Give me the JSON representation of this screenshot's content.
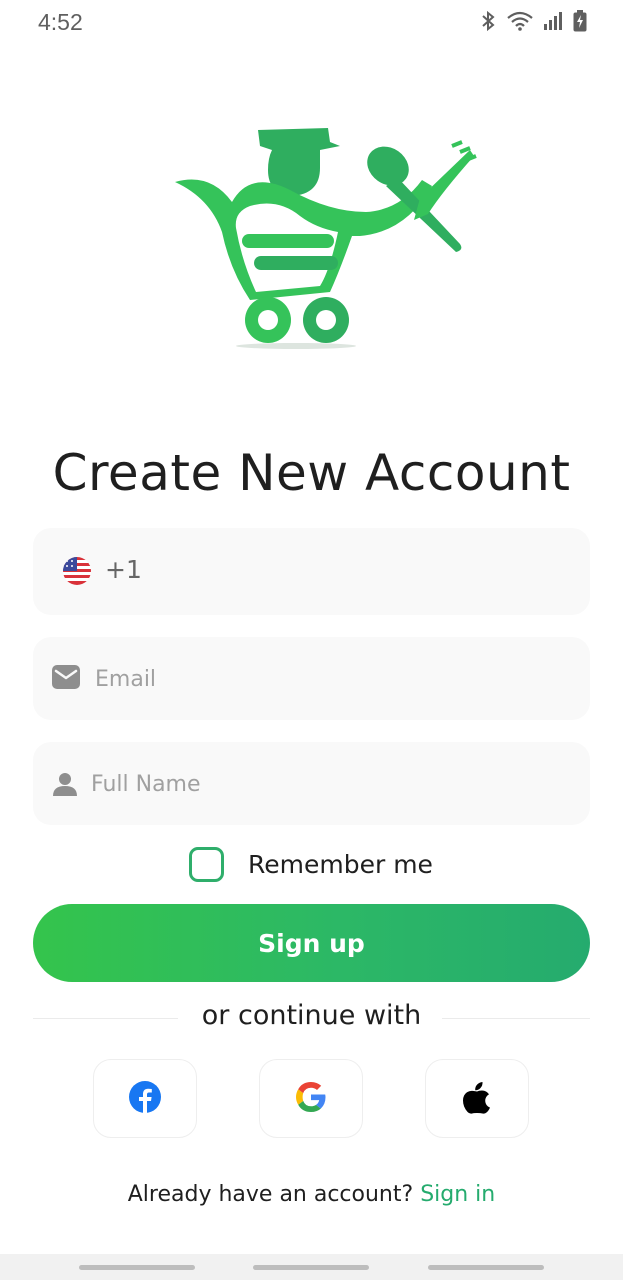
{
  "status_bar": {
    "time": "4:52",
    "icons": [
      "bluetooth-icon",
      "wifi-icon",
      "signal-icon",
      "battery-charging-icon"
    ]
  },
  "logo": {
    "icon": "shopping-cart-chef-spoon-fork-logo",
    "colors": [
      "#2fae5f",
      "#3fcb5a"
    ]
  },
  "title": "Create New Account",
  "phone": {
    "flag": "us-flag-icon",
    "code": "+1"
  },
  "email": {
    "placeholder": "Email",
    "value": "",
    "icon": "mail-icon"
  },
  "full_name": {
    "placeholder": "Full Name",
    "value": "",
    "icon": "user-icon"
  },
  "remember": {
    "label": "Remember me",
    "checked": false
  },
  "signup_button": {
    "label": "Sign up"
  },
  "divider_text": "or continue with",
  "social": [
    "facebook-icon",
    "google-icon",
    "apple-icon"
  ],
  "signin": {
    "prompt": "Already have an account?",
    "link": "Sign in"
  },
  "colors": {
    "accent": "#25ab6e",
    "accent_light": "#34c44c",
    "field_bg": "#f9f9f9"
  }
}
